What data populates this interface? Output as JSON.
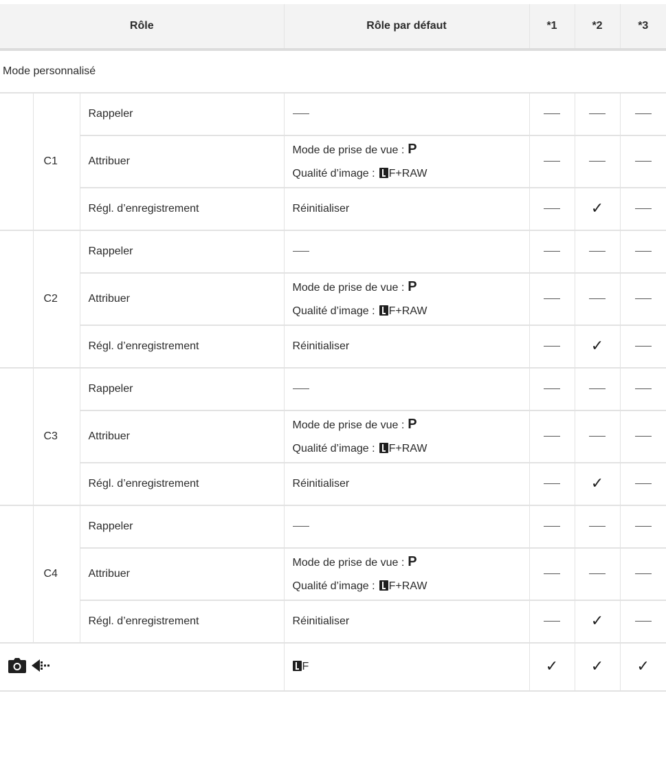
{
  "header": {
    "role": "Rôle",
    "default_role": "Rôle par défaut",
    "m1": "*1",
    "m2": "*2",
    "m3": "*3"
  },
  "section": {
    "title": "Mode personnalisé"
  },
  "groups": [
    {
      "name": "C1",
      "rows": [
        {
          "role": "Rappeler",
          "default": "—",
          "marks": [
            "—",
            "—",
            "—"
          ]
        },
        {
          "role": "Attribuer",
          "default_line1": "Mode de prise de vue :",
          "default_line1_value": "P",
          "default_line2": "Qualité d’image :",
          "default_line2_value": "F+RAW",
          "marks": [
            "—",
            "—",
            "—"
          ]
        },
        {
          "role": "Régl. d’enregistrement",
          "default": "Réinitialiser",
          "marks": [
            "—",
            "✓",
            "—"
          ]
        }
      ]
    },
    {
      "name": "C2",
      "rows": [
        {
          "role": "Rappeler",
          "default": "—",
          "marks": [
            "—",
            "—",
            "—"
          ]
        },
        {
          "role": "Attribuer",
          "default_line1": "Mode de prise de vue :",
          "default_line1_value": "P",
          "default_line2": "Qualité d’image :",
          "default_line2_value": "F+RAW",
          "marks": [
            "—",
            "—",
            "—"
          ]
        },
        {
          "role": "Régl. d’enregistrement",
          "default": "Réinitialiser",
          "marks": [
            "—",
            "✓",
            "—"
          ]
        }
      ]
    },
    {
      "name": "C3",
      "rows": [
        {
          "role": "Rappeler",
          "default": "—",
          "marks": [
            "—",
            "—",
            "—"
          ]
        },
        {
          "role": "Attribuer",
          "default_line1": "Mode de prise de vue :",
          "default_line1_value": "P",
          "default_line2": "Qualité d’image :",
          "default_line2_value": "F+RAW",
          "marks": [
            "—",
            "—",
            "—"
          ]
        },
        {
          "role": "Régl. d’enregistrement",
          "default": "Réinitialiser",
          "marks": [
            "—",
            "✓",
            "—"
          ]
        }
      ]
    },
    {
      "name": "C4",
      "rows": [
        {
          "role": "Rappeler",
          "default": "—",
          "marks": [
            "—",
            "—",
            "—"
          ]
        },
        {
          "role": "Attribuer",
          "default_line1": "Mode de prise de vue :",
          "default_line1_value": "P",
          "default_line2": "Qualité d’image :",
          "default_line2_value": "F+RAW",
          "marks": [
            "—",
            "—",
            "—"
          ]
        },
        {
          "role": "Régl. d’enregistrement",
          "default": "Réinitialiser",
          "marks": [
            "—",
            "✓",
            "—"
          ]
        }
      ]
    }
  ],
  "footer_row": {
    "icons": [
      "camera-icon",
      "drive-mode-icon"
    ],
    "default_value": "F",
    "marks": [
      "✓",
      "✓",
      "✓"
    ]
  }
}
